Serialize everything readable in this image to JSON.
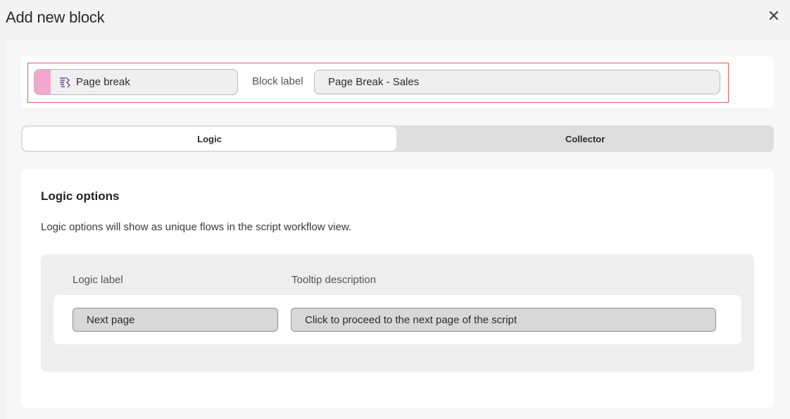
{
  "dialog": {
    "title": "Add new block",
    "close_icon": "close-icon"
  },
  "block": {
    "type_label": "Page break",
    "type_icon": "page-break-icon",
    "type_color": "#f2a7cf",
    "label_caption": "Block label",
    "label_value": "Page Break - Sales"
  },
  "tabs": [
    {
      "label": "Logic",
      "active": true
    },
    {
      "label": "Collector",
      "active": false
    }
  ],
  "logic": {
    "heading": "Logic options",
    "description": "Logic options will show as unique flows in the script workflow view.",
    "col_label": "Logic label",
    "col_tooltip": "Tooltip description",
    "options": [
      {
        "label": "Next page",
        "tooltip": "Click to proceed to the next page of the script"
      }
    ]
  },
  "colors": {
    "highlight_border": "#e55a5a"
  }
}
